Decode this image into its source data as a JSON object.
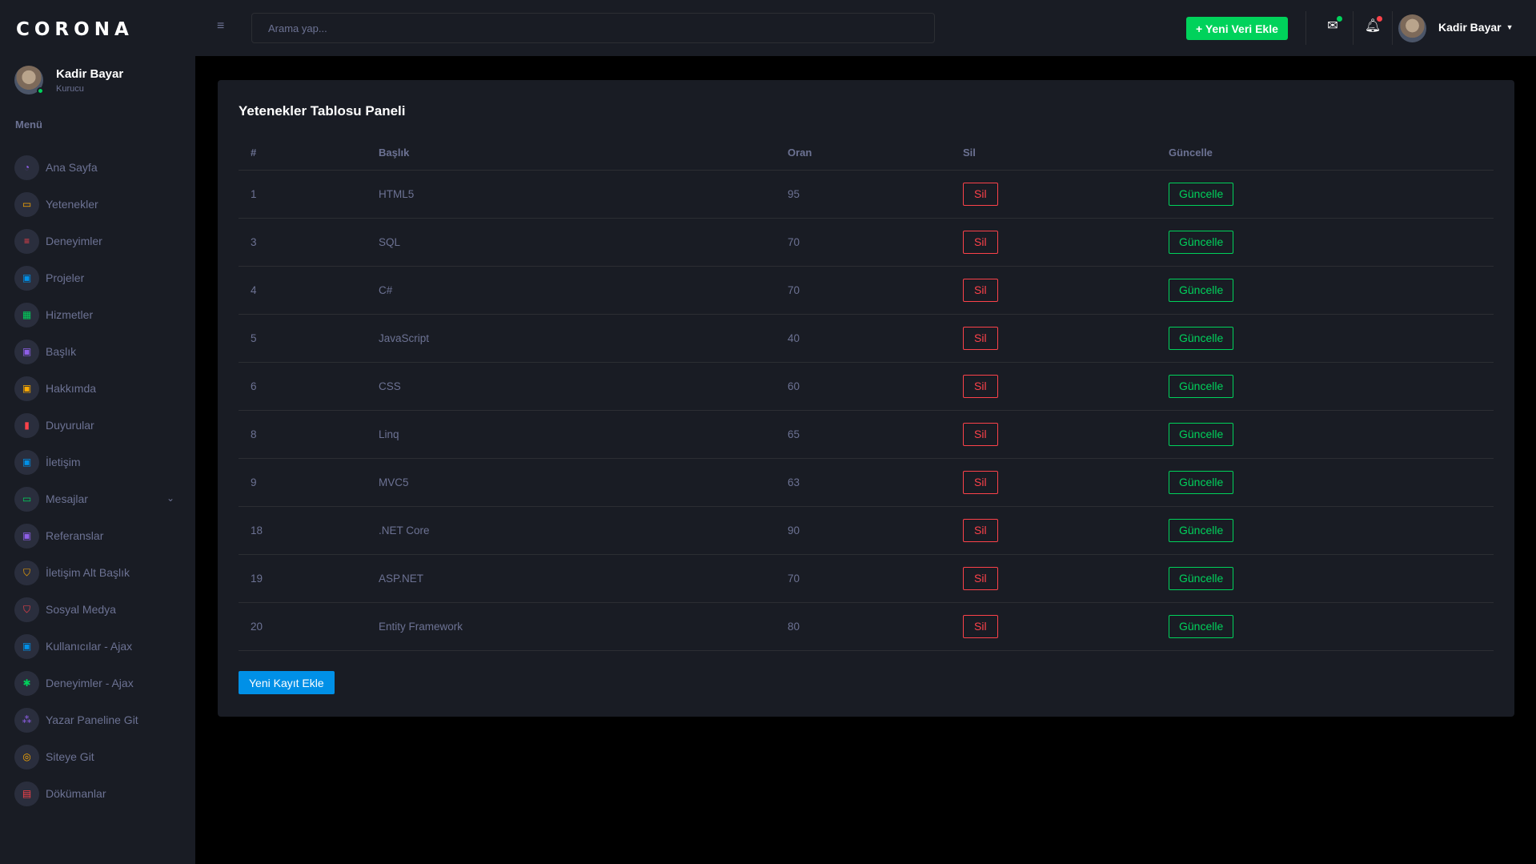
{
  "brand": "CORONA",
  "profile": {
    "name": "Kadir Bayar",
    "role": "Kurucu"
  },
  "menu_title": "Menü",
  "nav": [
    {
      "label": "Ana Sayfa",
      "icon": "speedometer-icon",
      "glyph": "◔",
      "color": "#8f5fe8"
    },
    {
      "label": "Yetenekler",
      "icon": "laptop-icon",
      "glyph": "▭",
      "color": "#ffab00"
    },
    {
      "label": "Deneyimler",
      "icon": "playlist-icon",
      "glyph": "≡",
      "color": "#fc424a"
    },
    {
      "label": "Projeler",
      "icon": "contacts-icon",
      "glyph": "▣",
      "color": "#0090e7"
    },
    {
      "label": "Hizmetler",
      "icon": "table-icon",
      "glyph": "▦",
      "color": "#00d25b"
    },
    {
      "label": "Başlık",
      "icon": "contacts-icon",
      "glyph": "▣",
      "color": "#8f5fe8"
    },
    {
      "label": "Hakkımda",
      "icon": "contacts-icon",
      "glyph": "▣",
      "color": "#ffab00"
    },
    {
      "label": "Duyurular",
      "icon": "bookmark-icon",
      "glyph": "▮",
      "color": "#fc424a"
    },
    {
      "label": "İletişim",
      "icon": "contacts-icon",
      "glyph": "▣",
      "color": "#0090e7"
    },
    {
      "label": "Mesajlar",
      "icon": "laptop-icon",
      "glyph": "▭",
      "color": "#00d25b",
      "chevron": true
    },
    {
      "label": "Referanslar",
      "icon": "contacts-icon",
      "glyph": "▣",
      "color": "#8f5fe8"
    },
    {
      "label": "İletişim Alt Başlık",
      "icon": "shield-icon",
      "glyph": "⛉",
      "color": "#ffab00"
    },
    {
      "label": "Sosyal Medya",
      "icon": "shield-icon",
      "glyph": "⛉",
      "color": "#fc424a"
    },
    {
      "label": "Kullanıcılar - Ajax",
      "icon": "contacts-icon",
      "glyph": "▣",
      "color": "#0090e7"
    },
    {
      "label": "Deneyimler - Ajax",
      "icon": "gear-icon",
      "glyph": "✱",
      "color": "#00d25b"
    },
    {
      "label": "Yazar Paneline Git",
      "icon": "group-icon",
      "glyph": "⁂",
      "color": "#8f5fe8"
    },
    {
      "label": "Siteye Git",
      "icon": "globe-icon",
      "glyph": "◎",
      "color": "#ffab00"
    },
    {
      "label": "Dökümanlar",
      "icon": "document-icon",
      "glyph": "▤",
      "color": "#fc424a"
    }
  ],
  "topbar": {
    "search_placeholder": "Arama yap...",
    "add_button": "+ Yeni Veri Ekle",
    "user_name": "Kadir Bayar",
    "mail_badge_color": "#00d25b",
    "bell_badge_color": "#fc424a"
  },
  "card": {
    "title": "Yetenekler Tablosu Paneli",
    "columns": [
      "#",
      "Başlık",
      "Oran",
      "Sil",
      "Güncelle"
    ],
    "rows": [
      {
        "id": "1",
        "title": "HTML5",
        "rate": "95"
      },
      {
        "id": "3",
        "title": "SQL",
        "rate": "70"
      },
      {
        "id": "4",
        "title": "C#",
        "rate": "70"
      },
      {
        "id": "5",
        "title": "JavaScript",
        "rate": "40"
      },
      {
        "id": "6",
        "title": "CSS",
        "rate": "60"
      },
      {
        "id": "8",
        "title": "Linq",
        "rate": "65"
      },
      {
        "id": "9",
        "title": "MVC5",
        "rate": "63"
      },
      {
        "id": "18",
        "title": ".NET Core",
        "rate": "90"
      },
      {
        "id": "19",
        "title": "ASP.NET",
        "rate": "70"
      },
      {
        "id": "20",
        "title": "Entity Framework",
        "rate": "80"
      }
    ],
    "delete_label": "Sil",
    "update_label": "Güncelle",
    "new_record_button": "Yeni Kayıt Ekle"
  },
  "colors": {
    "sidebar_bg": "#191c24",
    "page_bg": "#000000",
    "success": "#00d25b",
    "danger": "#fc424a",
    "primary": "#0090e7",
    "muted": "#6c7293"
  }
}
